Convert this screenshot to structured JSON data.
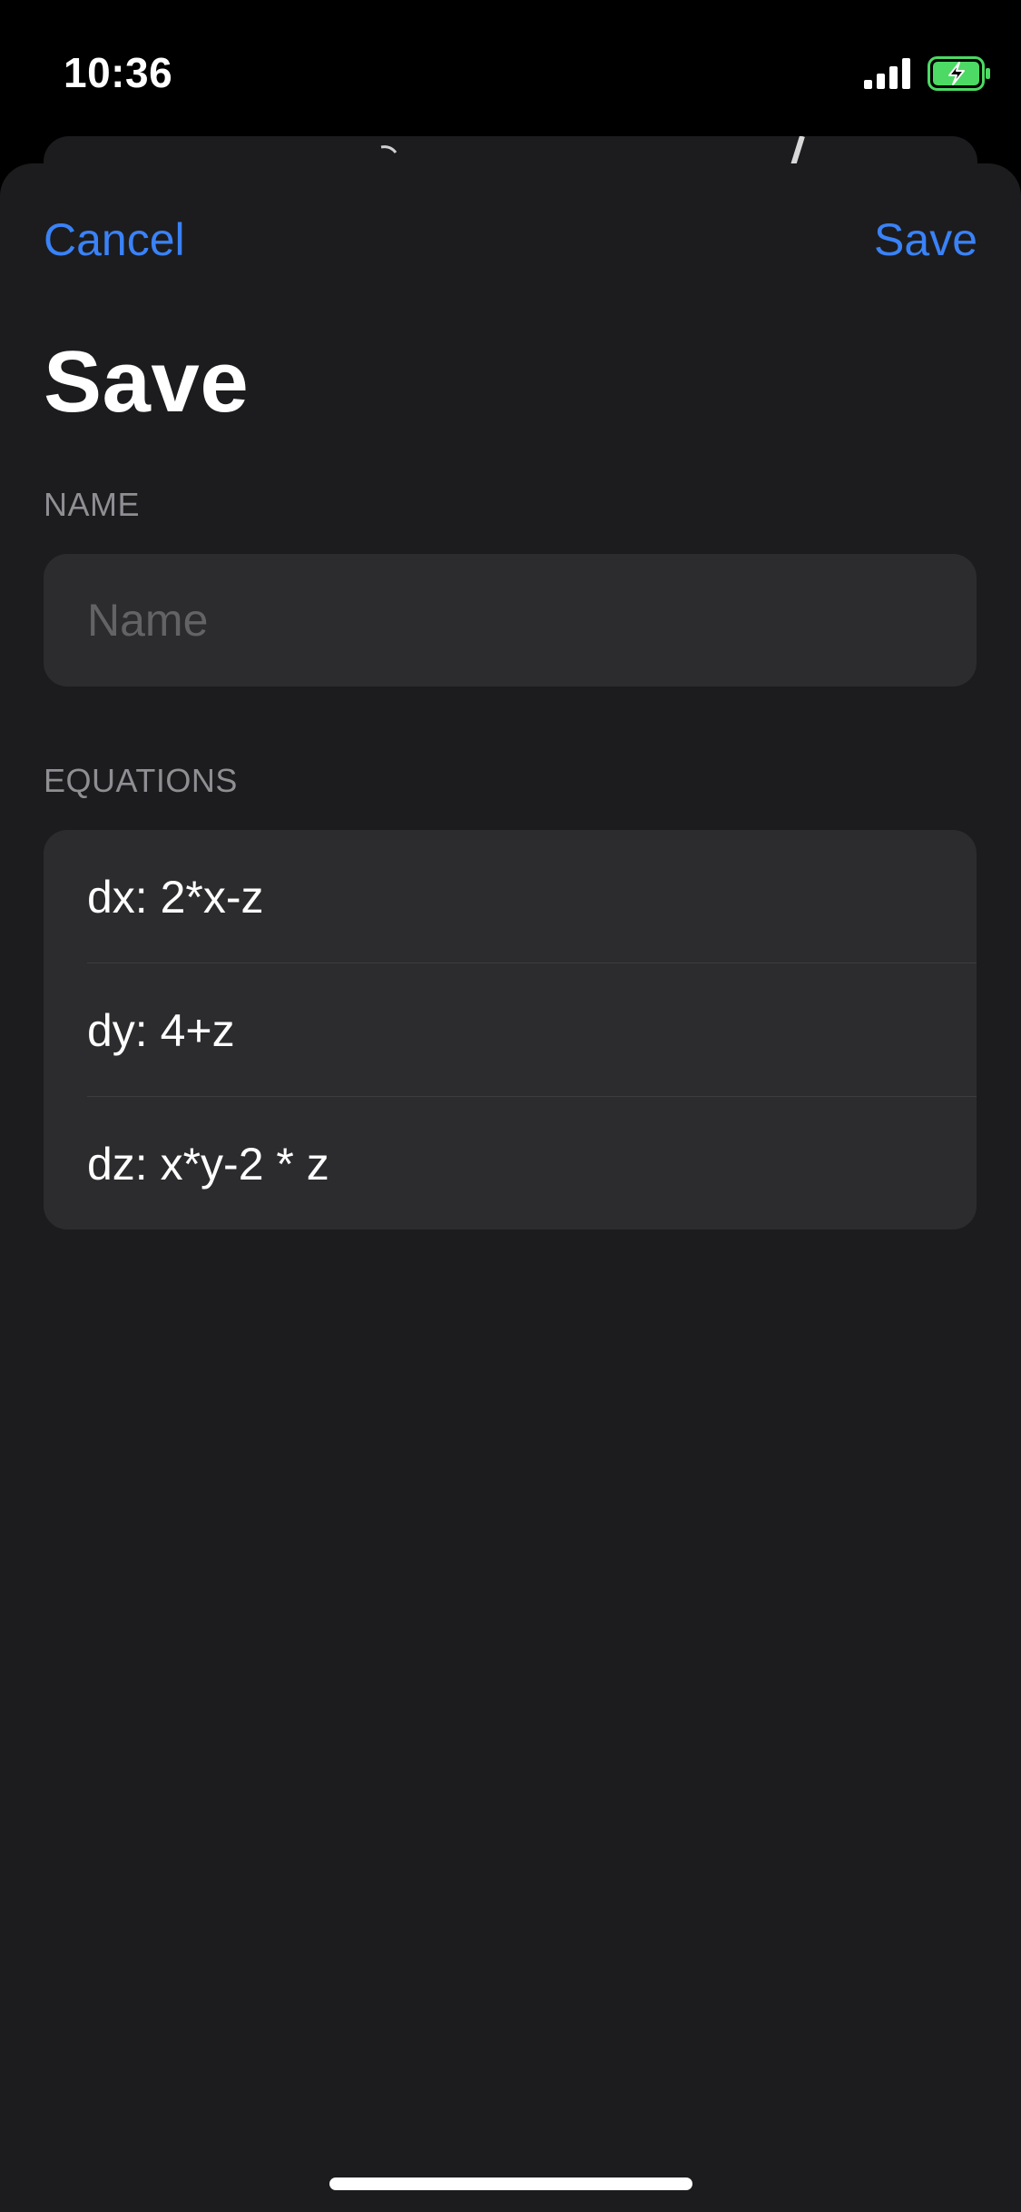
{
  "status_bar": {
    "time": "10:36",
    "signal_icon": "cellular-signal-icon",
    "battery_icon": "battery-charging-icon",
    "battery_color": "#4cd964"
  },
  "nav": {
    "cancel_label": "Cancel",
    "save_label": "Save"
  },
  "title": "Save",
  "name_section": {
    "header": "NAME",
    "value": "",
    "placeholder": "Name"
  },
  "equations_section": {
    "header": "EQUATIONS",
    "rows": [
      {
        "label": "dx: 2*x-z"
      },
      {
        "label": "dy: 4+z"
      },
      {
        "label": "dz: x*y-2 * z"
      }
    ]
  },
  "colors": {
    "accent": "#3a82f7",
    "sheet_background": "#1c1c1e",
    "group_background": "#2c2c2e",
    "secondary_text": "#8e8e93"
  }
}
